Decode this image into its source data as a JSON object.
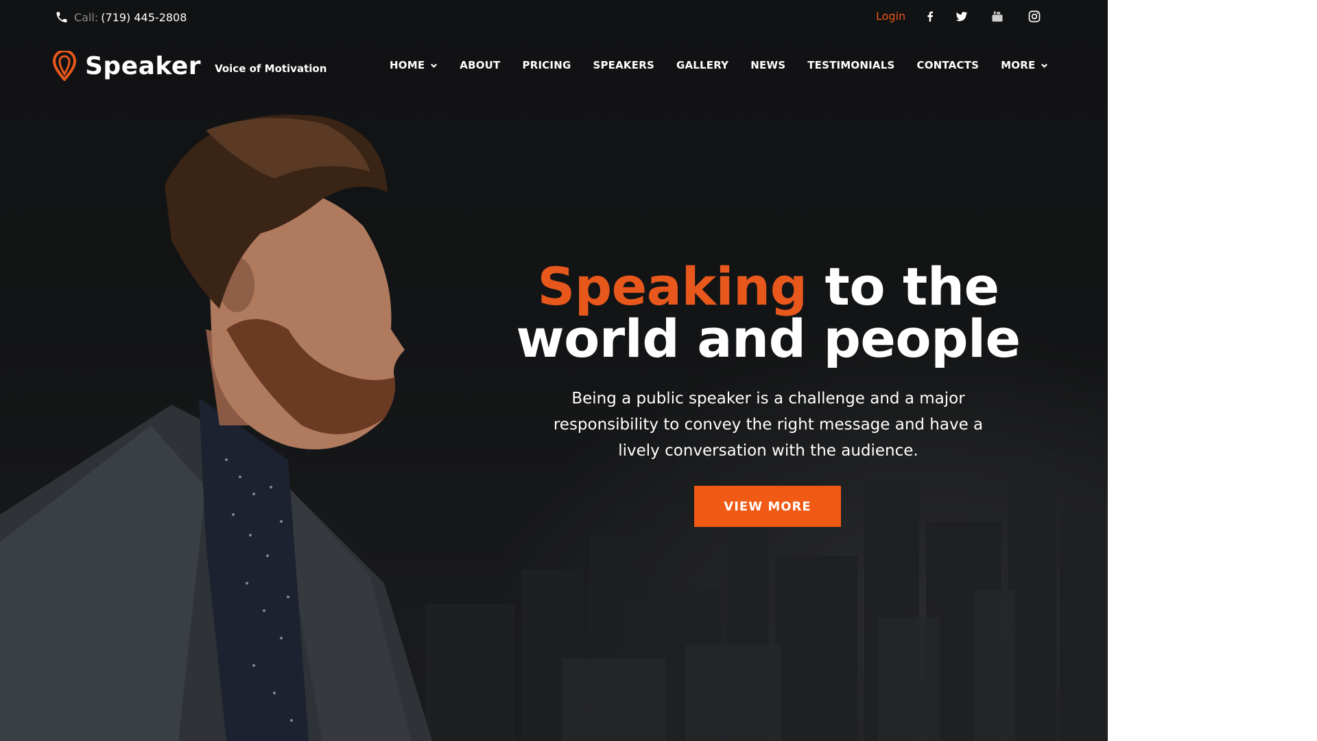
{
  "topbar": {
    "call_label": "Call:",
    "phone": "(719) 445-2808",
    "login": "Login",
    "social_icons": [
      "facebook-icon",
      "twitter-icon",
      "youtube-icon",
      "instagram-icon"
    ]
  },
  "brand": {
    "name": "Speaker",
    "tagline": "Voice of Motivation"
  },
  "nav": {
    "items": [
      {
        "label": "HOME",
        "has_dropdown": true
      },
      {
        "label": "ABOUT",
        "has_dropdown": false
      },
      {
        "label": "PRICING",
        "has_dropdown": false
      },
      {
        "label": "SPEAKERS",
        "has_dropdown": false
      },
      {
        "label": "GALLERY",
        "has_dropdown": false
      },
      {
        "label": "NEWS",
        "has_dropdown": false
      },
      {
        "label": "TESTIMONIALS",
        "has_dropdown": false
      },
      {
        "label": "CONTACTS",
        "has_dropdown": false
      },
      {
        "label": "MORE",
        "has_dropdown": true
      }
    ]
  },
  "hero": {
    "headline_accent": "Speaking",
    "headline_rest_1": " to the",
    "headline_line_2": "world and people",
    "subtext": "Being a public speaker is a challenge and a major responsibility to convey the right message and have a lively conversation with the audience.",
    "cta": "VIEW MORE"
  },
  "colors": {
    "accent": "#e8581c",
    "button": "#f05a14",
    "background": "#131415"
  }
}
